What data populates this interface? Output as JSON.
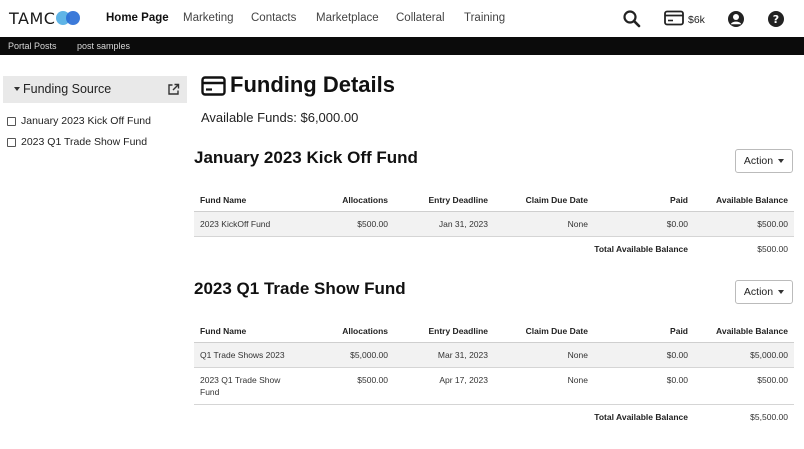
{
  "nav": {
    "logo_text": "TAMC",
    "items": [
      "Home Page",
      "Marketing",
      "Contacts",
      "Marketplace",
      "Collateral",
      "Training"
    ],
    "funds_badge": "$6k"
  },
  "subnav": {
    "items": [
      "Portal Posts",
      "post samples"
    ]
  },
  "sidebar": {
    "header": "Funding Source",
    "funds": [
      "January 2023 Kick Off Fund",
      "2023 Q1 Trade Show Fund"
    ]
  },
  "main": {
    "title": "Funding Details",
    "available_funds": "Available Funds: $6,000.00",
    "columns": [
      "Fund Name",
      "Allocations",
      "Entry Deadline",
      "Claim Due Date",
      "Paid",
      "Available Balance"
    ],
    "total_label": "Total Available Balance",
    "action_label": "Action",
    "sections": [
      {
        "title": "January 2023 Kick Off Fund",
        "rows": [
          [
            "2023 KickOff Fund",
            "$500.00",
            "Jan 31, 2023",
            "None",
            "$0.00",
            "$500.00"
          ]
        ],
        "total": "$500.00"
      },
      {
        "title": "2023 Q1 Trade Show Fund",
        "rows": [
          [
            "Q1 Trade Shows 2023",
            "$5,000.00",
            "Mar 31, 2023",
            "None",
            "$0.00",
            "$5,000.00"
          ],
          [
            "2023 Q1 Trade Show Fund",
            "$500.00",
            "Apr 17, 2023",
            "None",
            "$0.00",
            "$500.00"
          ]
        ],
        "total": "$5,500.00"
      }
    ]
  },
  "colors": {
    "subnav_bg": "#0b0b0b",
    "logo_light": "#5fb4e6",
    "logo_dark": "#2b6fd6",
    "row_alt": "#f2f2f2"
  },
  "icons": [
    "search-icon",
    "wallet-icon",
    "user-account-icon",
    "help-icon",
    "external-link-icon",
    "credit-card-icon",
    "chevron-down-icon"
  ]
}
